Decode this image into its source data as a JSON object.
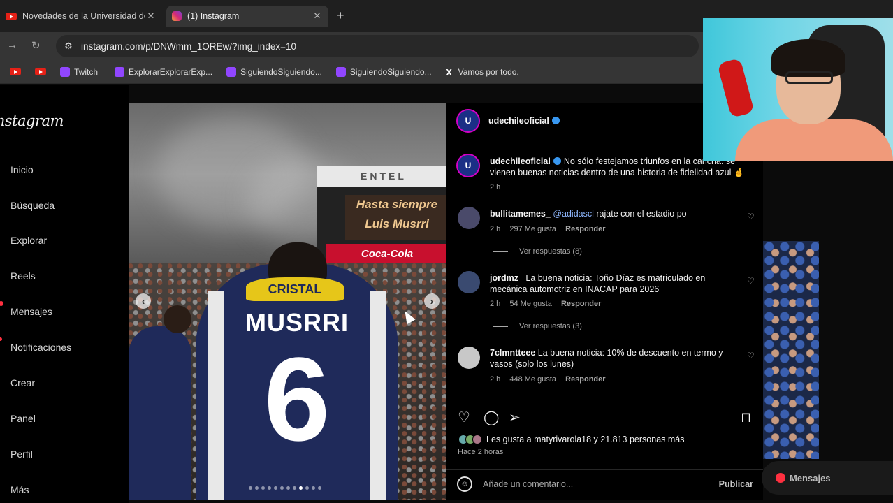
{
  "browser": {
    "tabs": [
      {
        "title": "Novedades de la Universidad de",
        "active": false
      },
      {
        "title": "(1) Instagram",
        "active": true
      }
    ],
    "url": "instagram.com/p/DNWmm_1OREw/?img_index=10",
    "bookmarks": [
      {
        "label": "",
        "icon": "youtube-icon"
      },
      {
        "label": "",
        "icon": "youtube-icon"
      },
      {
        "label": "Twitch",
        "icon": "twitch-icon"
      },
      {
        "label": "ExplorarExplorarExp...",
        "icon": "twitch-icon"
      },
      {
        "label": "SiguiendoSiguiendo...",
        "icon": "twitch-icon"
      },
      {
        "label": "SiguiendoSiguiendo...",
        "icon": "twitch-icon"
      },
      {
        "label": "Vamos por todo.",
        "icon": "x-icon"
      }
    ]
  },
  "sidebar": {
    "logo": "Instagram",
    "items": [
      "Inicio",
      "Búsqueda",
      "Explorar",
      "Reels",
      "Mensajes",
      "Notificaciones",
      "Crear",
      "Panel",
      "Perfil",
      "Más"
    ]
  },
  "photo": {
    "scoreboard_top": "ENTEL",
    "scoreboard_message": "Hasta siempre Luis Musrri",
    "scoreboard_ad": "Coca-Cola",
    "sponsor": "CRISTAL",
    "jersey_name": "MUSRRI",
    "jersey_number": "6",
    "carousel_count": 12,
    "carousel_active": 9
  },
  "post": {
    "author": "udechileoficial",
    "caption_author": "udechileoficial",
    "caption": "No sólo festejamos triunfos en la cancha: se vienen buenas noticias dentro de una historia de fidelidad azul 🤞",
    "caption_time": "2 h",
    "comments": [
      {
        "user": "bullitamemes_",
        "mention": "@adidascl",
        "text": "rajate con el estadio po",
        "time": "2 h",
        "likes": "297 Me gusta",
        "reply": "Responder",
        "view_replies": "Ver respuestas (8)"
      },
      {
        "user": "jordmz_",
        "mention": "",
        "text": "La buena noticia: Toño Díaz es matriculado en mecánica automotriz en INACAP para 2026",
        "time": "2 h",
        "likes": "54 Me gusta",
        "reply": "Responder",
        "view_replies": "Ver respuestas (3)"
      },
      {
        "user": "7clmntteee",
        "mention": "",
        "text": "La buena noticia: 10% de descuento en termo y vasos (solo los lunes)",
        "time": "2 h",
        "likes": "448 Me gusta",
        "reply": "Responder",
        "view_replies": ""
      }
    ],
    "likes_text": "Les gusta a matyrivarola18 y 21.813 personas más",
    "posted_ago": "Hace 2 horas",
    "comment_placeholder": "Añade un comentario...",
    "publish": "Publicar"
  },
  "floating": {
    "messages": "Mensajes"
  },
  "colors": {
    "accent_blue": "#3897f0",
    "notification_red": "#ff3040",
    "background": "#000000"
  }
}
